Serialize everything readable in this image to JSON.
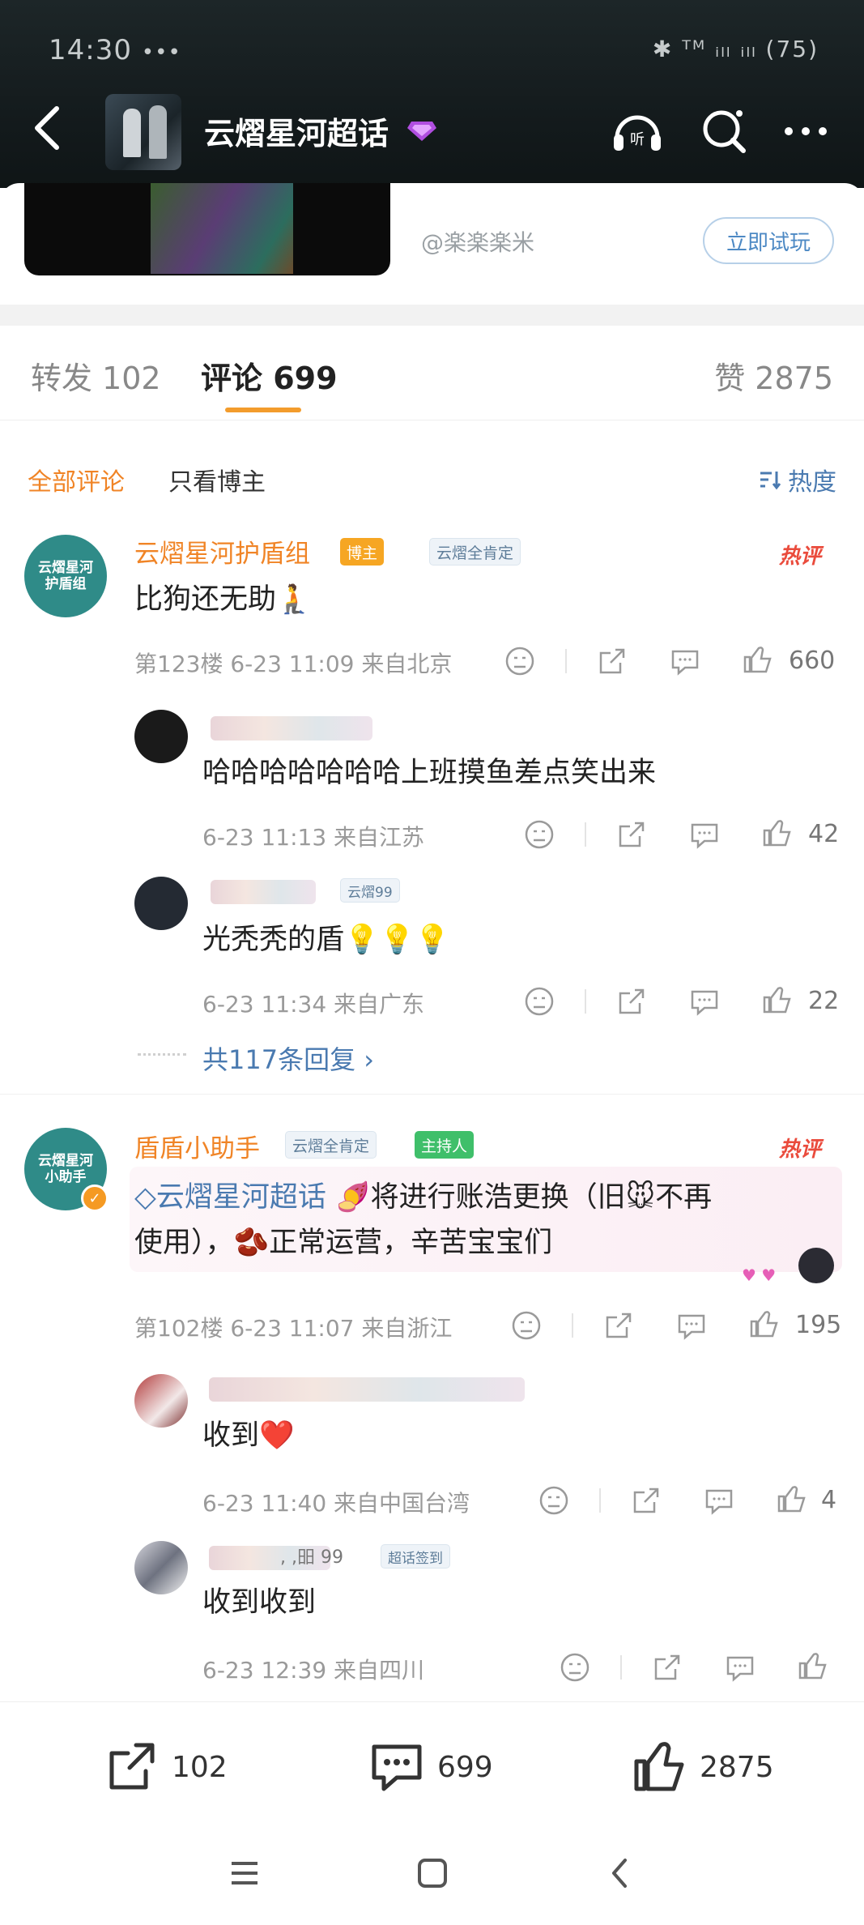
{
  "status_bar": {
    "time": "14:30",
    "extra": "•••",
    "right": "✱ ᵀᴹ ᵢₗₗ ᵢₗₗ (75)"
  },
  "header": {
    "topic_title": "云熠星河超话"
  },
  "media_card": {
    "source": "@楽楽楽米",
    "try_button": "立即试玩"
  },
  "tabs": {
    "repost": "转发 102",
    "comment": "评论 699",
    "like": "赞 2875"
  },
  "filters": {
    "all": "全部评论",
    "author_only": "只看博主",
    "sort": "热度"
  },
  "comments": [
    {
      "avatar_text": "云熠星河\n护盾组",
      "username": "云熠星河护盾组",
      "badge_host": "博主",
      "badge_verify": "云熠全肯定",
      "hot": "热评",
      "text": "比狗还无助🧎",
      "meta": "第123楼  6-23 11:09  来自北京",
      "likes": "660",
      "replies": [
        {
          "text": "哈哈哈哈哈哈哈上班摸鱼差点笑出来",
          "meta": "6-23 11:13  来自江苏",
          "likes": "42"
        },
        {
          "text": "光秃秃的盾💡💡💡",
          "meta": "6-23 11:34  来自广东",
          "likes": "22",
          "badge": "云熠99"
        }
      ],
      "more_replies": "共117条回复 ›"
    },
    {
      "avatar_text": "云熠星河\n小助手",
      "username": "盾盾小助手",
      "badge_verify": "云熠全肯定",
      "badge_mod": "主持人",
      "hot": "热评",
      "topic_link": "云熠星河超话",
      "text_line1_after": "将进行账浩更换（旧🐭不再",
      "text_line2": "使用），🫘正常运营，辛苦宝宝们",
      "meta": "第102楼  6-23 11:07  来自浙江",
      "likes": "195",
      "replies": [
        {
          "text": "收到❤️",
          "meta": "6-23 11:40  来自中国台湾",
          "likes": "4"
        },
        {
          "text": "收到收到",
          "meta": "6-23 12:39  来自四川",
          "likes": "",
          "badge": "超话签到",
          "name_partial": ", ,昍 99"
        }
      ]
    }
  ],
  "bottom_bar": {
    "repost": "102",
    "comment": "699",
    "like": "2875"
  }
}
